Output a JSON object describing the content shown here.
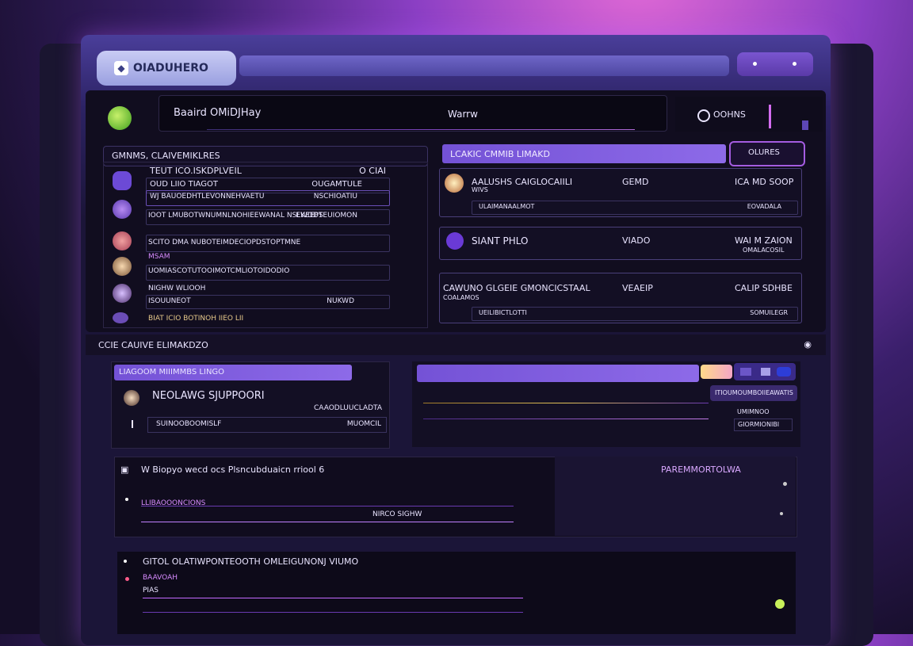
{
  "app": {
    "brand": "OIADUHERO"
  },
  "header": {
    "search_left": "Baaird OMiDJHay",
    "search_center": "Warrw",
    "options_label": "OOHNS"
  },
  "left_list": {
    "title": "GMNMS,  CLAIVEMIKLRES",
    "rows": [
      {
        "a": "TEUT ICO.ISKDPLVEIL",
        "b": "O CIAI"
      },
      {
        "a": "OUD LIIO TIAGOT",
        "b": "OUGAMTULE"
      },
      {
        "a": "WJ BAUOEDHTLEVONNEHVAETU",
        "b": "NSCHIOATIU"
      },
      {
        "a": "IOOT LMUBOTWNUMNLNOHIEEWANAL NSLKEEPS",
        "b": "EWODTEUIOMON"
      },
      {
        "a": "SCITO DMA NUBOTEIMDECIOPDSTOPTMNE",
        "b": ""
      },
      {
        "a": "MSAM",
        "b": ""
      },
      {
        "a": "UOMIASCOTUTOOIMOTCMLIOTOIDODIO",
        "b": ""
      },
      {
        "a": "NIGHW WLIOOH",
        "b": ""
      },
      {
        "a": "ISOUUNEOT",
        "b": "NUKWD"
      },
      {
        "a": "BIAT ICIO BOTINOH IIEO LII",
        "b": ""
      }
    ]
  },
  "right_cards": {
    "header": "LCAKIC   CMMIB LIMAKD",
    "button": "OLURES",
    "cards": [
      {
        "name": "AALUSHS CAIGLOCAIILI",
        "sub": "WIVS",
        "mid": "GEMD",
        "right": "ICA MD SOOP",
        "line_l": "ULAIMANAALMOT",
        "line_r": "EOVADALA"
      },
      {
        "name": "SIANT PHLO",
        "sub": "",
        "mid": "VIADO",
        "right": "WAI M ZAION",
        "line_l": "",
        "line_r": "OMALACOSIL"
      },
      {
        "name": "CAWUNO GLGEIE GMONCICSTAAL",
        "sub": "COALAMOS",
        "mid": "VEAEIP",
        "right": "CALIP SDHBE",
        "line_l": "UEILIBICTLOTTI",
        "line_r": "SOMUILEGR"
      }
    ]
  },
  "section": {
    "title": "CCIE  CAUIVE  ELIMAKDZO"
  },
  "support": {
    "tab": "LIAGOOM  MIIIMMBS  LINGO",
    "title": "NEOLAWG SJUPPOORI",
    "caption": "CAAODLUUCLADTA",
    "row_left": "SUINOOBOOMISLF",
    "row_right": "MUOMCIL"
  },
  "activity": {
    "badge1": "ITIOUMOUMBOIIEAWATIS",
    "badge2": "UMIMNOO",
    "badge3": "GIORMIONIBI"
  },
  "feed": {
    "title": "W Biopyo  wecd ocs Plsncubduaicn  rriool 6",
    "right_title": "PAREMMORTOLWA",
    "row_left": "LLIBAOOONCIONS",
    "row_mid": "NIRCO SIGHW"
  },
  "feed2": {
    "title": "GITOL  OLATIWPONTEOOTH   OMLEIGUNONJ  VIUMO",
    "tag1": "BAAVOAH",
    "tag2": "PIAS"
  },
  "colors": {
    "accent": "#7452d6",
    "bg": "#110d1f"
  }
}
